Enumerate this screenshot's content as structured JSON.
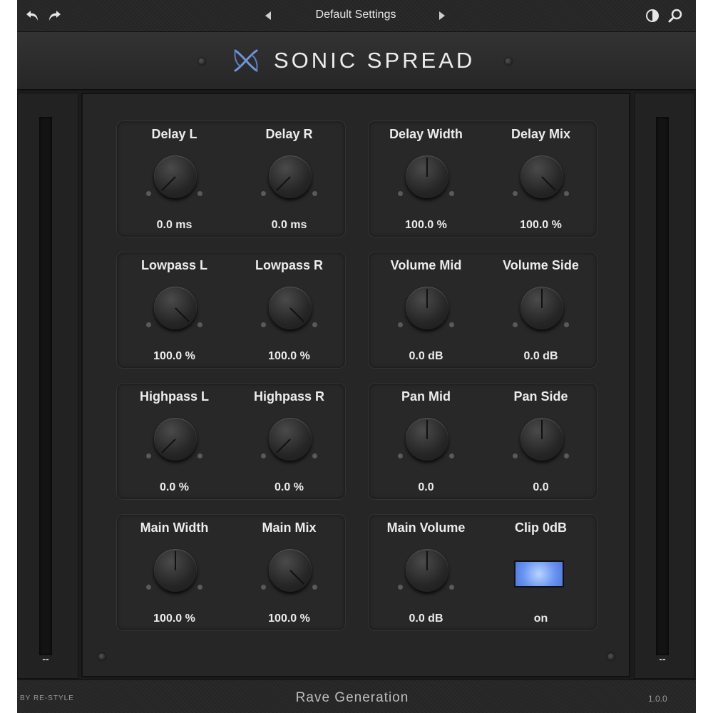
{
  "topbar": {
    "preset_name": "Default Settings",
    "icons": [
      "undo-icon",
      "redo-icon",
      "prev-preset-icon",
      "next-preset-icon",
      "contrast-icon",
      "zoom-icon"
    ]
  },
  "header": {
    "product_name": "SONIC SPREAD",
    "logo_icon": "sonic-spread-logo"
  },
  "meters": {
    "left_readout": "--",
    "right_readout": "--",
    "left_level": 0,
    "right_level": 0
  },
  "groups": [
    {
      "controls": [
        {
          "id": "delay-l",
          "label": "Delay L",
          "value": "0.0 ms",
          "position": 0
        },
        {
          "id": "delay-r",
          "label": "Delay R",
          "value": "0.0 ms",
          "position": 0
        }
      ]
    },
    {
      "controls": [
        {
          "id": "delay-width",
          "label": "Delay Width",
          "value": "100.0 %",
          "position": 0.5
        },
        {
          "id": "delay-mix",
          "label": "Delay Mix",
          "value": "100.0 %",
          "position": 1
        }
      ]
    },
    {
      "controls": [
        {
          "id": "lowpass-l",
          "label": "Lowpass L",
          "value": "100.0 %",
          "position": 1
        },
        {
          "id": "lowpass-r",
          "label": "Lowpass R",
          "value": "100.0 %",
          "position": 1
        }
      ]
    },
    {
      "controls": [
        {
          "id": "volume-mid",
          "label": "Volume Mid",
          "value": "0.0 dB",
          "position": 0.5
        },
        {
          "id": "volume-side",
          "label": "Volume Side",
          "value": "0.0 dB",
          "position": 0.5
        }
      ]
    },
    {
      "controls": [
        {
          "id": "highpass-l",
          "label": "Highpass L",
          "value": "0.0 %",
          "position": 0
        },
        {
          "id": "highpass-r",
          "label": "Highpass R",
          "value": "0.0 %",
          "position": 0
        }
      ]
    },
    {
      "controls": [
        {
          "id": "pan-mid",
          "label": "Pan Mid",
          "value": "0.0",
          "position": 0.5
        },
        {
          "id": "pan-side",
          "label": "Pan Side",
          "value": "0.0",
          "position": 0.5
        }
      ]
    },
    {
      "controls": [
        {
          "id": "main-width",
          "label": "Main Width",
          "value": "100.0 %",
          "position": 0.5
        },
        {
          "id": "main-mix",
          "label": "Main Mix",
          "value": "100.0 %",
          "position": 1
        }
      ]
    },
    {
      "controls": [
        {
          "id": "main-volume",
          "label": "Main Volume",
          "value": "0.0 dB",
          "position": 0.5
        },
        {
          "id": "clip-0db",
          "label": "Clip 0dB",
          "value": "on",
          "type": "toggle",
          "state": true
        }
      ]
    }
  ],
  "colors": {
    "accent": "#6a94f2",
    "panel": "#262626",
    "text": "#ececec"
  },
  "footer": {
    "by": "BY RE-STYLE",
    "brand": "Rave Generation",
    "version": "1.0.0"
  }
}
